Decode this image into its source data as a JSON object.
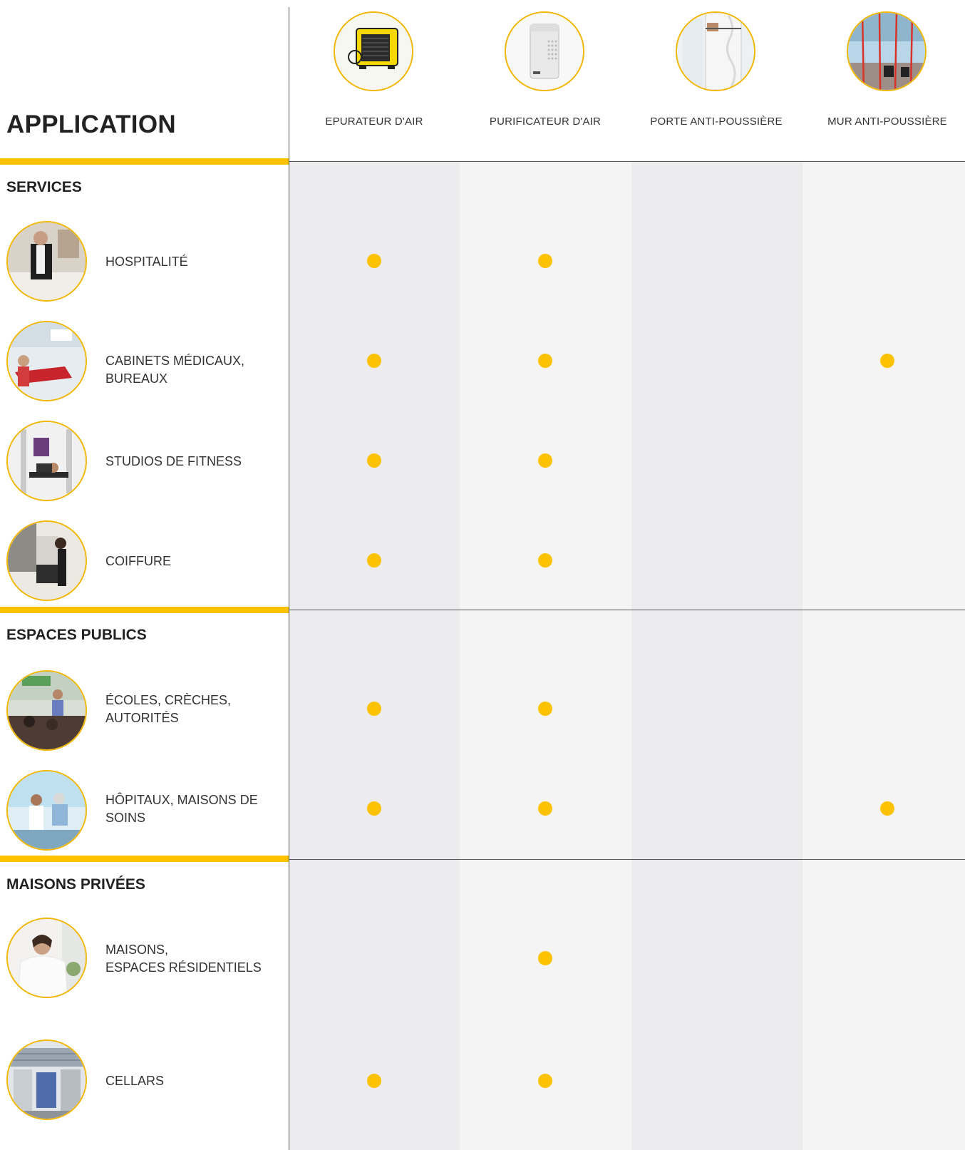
{
  "colors": {
    "accent": "#fcc200",
    "col_a": "#ececee",
    "col_b": "#f4f4f4"
  },
  "header": {
    "title": "APPLICATION"
  },
  "products": [
    {
      "label": "EPURATEUR D'AIR",
      "icon": "air-scrubber-image"
    },
    {
      "label": "PURIFICATEUR D'AIR",
      "icon": "air-purifier-image"
    },
    {
      "label": "PORTE ANTI-POUSSIÈRE",
      "icon": "dust-door-image"
    },
    {
      "label": "MUR ANTI-POUSSIÈRE",
      "icon": "dust-wall-image"
    }
  ],
  "sections": [
    {
      "title": "SERVICES",
      "rows": [
        {
          "label_lines": [
            "HOSPITALITÉ"
          ],
          "marks": [
            true,
            true,
            false,
            false
          ],
          "icon": "hospitality-photo"
        },
        {
          "label_lines": [
            "CABINETS MÉDICAUX,",
            "BUREAUX"
          ],
          "marks": [
            true,
            true,
            false,
            true
          ],
          "icon": "medical-office-photo"
        },
        {
          "label_lines": [
            "STUDIOS DE FITNESS"
          ],
          "marks": [
            true,
            true,
            false,
            false
          ],
          "icon": "fitness-photo"
        },
        {
          "label_lines": [
            "COIFFURE"
          ],
          "marks": [
            true,
            true,
            false,
            false
          ],
          "icon": "hairdresser-photo"
        }
      ]
    },
    {
      "title": "ESPACES PUBLICS",
      "rows": [
        {
          "label_lines": [
            "ÉCOLES, CRÈCHES,",
            "AUTORITÉS"
          ],
          "marks": [
            true,
            true,
            false,
            false
          ],
          "icon": "school-photo"
        },
        {
          "label_lines": [
            "HÔPITAUX, MAISONS DE",
            "SOINS"
          ],
          "marks": [
            true,
            true,
            false,
            true
          ],
          "icon": "hospital-photo"
        }
      ]
    },
    {
      "title": "MAISONS PRIVÉES",
      "rows": [
        {
          "label_lines": [
            "MAISONS,",
            "ESPACES RÉSIDENTIELS"
          ],
          "marks": [
            false,
            true,
            false,
            false
          ],
          "icon": "home-photo"
        },
        {
          "label_lines": [
            "CELLARS"
          ],
          "marks": [
            true,
            true,
            false,
            false
          ],
          "icon": "cellar-photo"
        }
      ]
    }
  ]
}
